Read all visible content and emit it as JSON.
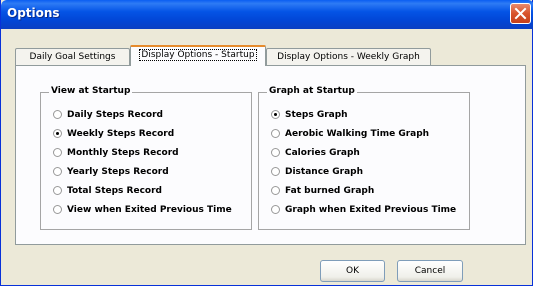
{
  "window": {
    "title": "Options",
    "close_icon": "close-icon"
  },
  "tabs": [
    {
      "label": "Daily Goal Settings",
      "active": false
    },
    {
      "label": "Display Options - Startup",
      "active": true
    },
    {
      "label": "Display Options - Weekly Graph",
      "active": false
    }
  ],
  "view_group": {
    "title": "View at Startup",
    "options": [
      {
        "label": "Daily Steps Record",
        "checked": false
      },
      {
        "label": "Weekly Steps Record",
        "checked": true
      },
      {
        "label": "Monthly Steps Record",
        "checked": false
      },
      {
        "label": "Yearly Steps Record",
        "checked": false
      },
      {
        "label": "Total Steps Record",
        "checked": false
      },
      {
        "label": "View when Exited Previous Time",
        "checked": false
      }
    ]
  },
  "graph_group": {
    "title": "Graph at Startup",
    "options": [
      {
        "label": "Steps Graph",
        "checked": true
      },
      {
        "label": "Aerobic Walking Time Graph",
        "checked": false
      },
      {
        "label": "Calories Graph",
        "checked": false
      },
      {
        "label": "Distance Graph",
        "checked": false
      },
      {
        "label": "Fat burned Graph",
        "checked": false
      },
      {
        "label": "Graph when Exited Previous Time",
        "checked": false
      }
    ]
  },
  "buttons": {
    "ok": "OK",
    "cancel": "Cancel"
  },
  "colors": {
    "titlebar": "#0454e6",
    "close": "#d8532c",
    "window_bg": "#ece9d8",
    "panel_bg": "#fcfcfe",
    "active_tab_accent": "#e68b2c"
  }
}
